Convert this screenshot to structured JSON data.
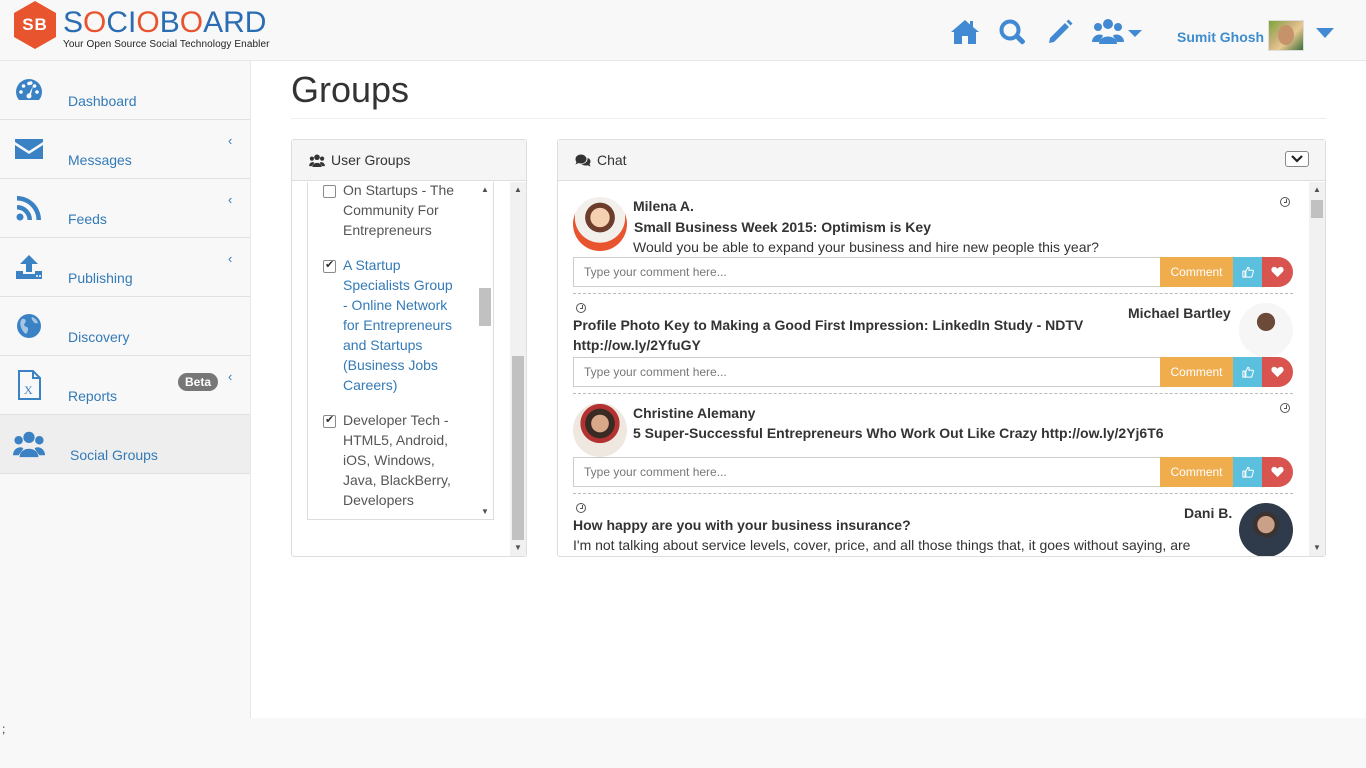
{
  "brand": {
    "logo_mark": "SB",
    "name_part1": "S",
    "name_o1": "O",
    "name_part2": "CI",
    "name_o2": "O",
    "name_part3": "B",
    "name_o3": "O",
    "name_part4": "ARD",
    "tagline": "Your Open Source Social Technology Enabler",
    "accent": "#e8542e",
    "primary": "#2a6db3"
  },
  "header": {
    "icons": [
      "home-icon",
      "search-icon",
      "pencil-icon",
      "users-dropdown-icon"
    ],
    "user_name": "Sumit Ghosh"
  },
  "sidebar": {
    "items": [
      {
        "label": "Dashboard",
        "icon": "dashboard-icon"
      },
      {
        "label": "Messages",
        "icon": "envelope-icon",
        "chevron": "‹"
      },
      {
        "label": "Feeds",
        "icon": "rss-icon",
        "chevron": "‹"
      },
      {
        "label": "Publishing",
        "icon": "upload-icon",
        "chevron": "‹"
      },
      {
        "label": "Discovery",
        "icon": "globe-icon"
      },
      {
        "label": "Reports",
        "icon": "excel-file-icon",
        "badge": "Beta",
        "chevron": "‹"
      },
      {
        "label": "Social Groups",
        "icon": "users-icon",
        "active": true
      }
    ]
  },
  "page": {
    "title": "Groups"
  },
  "groups_panel": {
    "title": "User Groups",
    "groups": [
      {
        "lines": [
          "On Startups - The",
          "Community For",
          "Entrepreneurs"
        ],
        "checked": false
      },
      {
        "lines": [
          "A Startup",
          "Specialists Group",
          "- Online Network",
          "for Entrepreneurs",
          "and Startups",
          "(Business Jobs",
          "Careers)"
        ],
        "checked": true
      },
      {
        "lines": [
          "Developer Tech -",
          "HTML5, Android,",
          "iOS, Windows,",
          "Java, BlackBerry,",
          "Developers"
        ],
        "checked": true
      }
    ]
  },
  "chat_panel": {
    "title": "Chat",
    "comment_placeholder": "Type your comment here...",
    "comment_label": "Comment",
    "posts": [
      {
        "author": "Milena A.",
        "title": "Small Business Week 2015: Optimism is Key",
        "body": "Would you be able to expand your business and hire new people this year?"
      },
      {
        "author": "Michael Bartley",
        "title": "Profile Photo Key to Making a Good First Impression: LinkedIn Study - NDTV",
        "link": "http://ow.ly/2YfuGY"
      },
      {
        "author": "Christine Alemany",
        "title": "5 Super-Successful Entrepreneurs Who Work Out Like Crazy http://ow.ly/2Yj6T6"
      },
      {
        "author": "Dani B.",
        "title": "How happy are you with your business insurance?",
        "body": "I'm not talking about service levels, cover, price, and all those things that, it goes without saying, are"
      }
    ]
  },
  "footer": {
    "stray_text": ";"
  }
}
